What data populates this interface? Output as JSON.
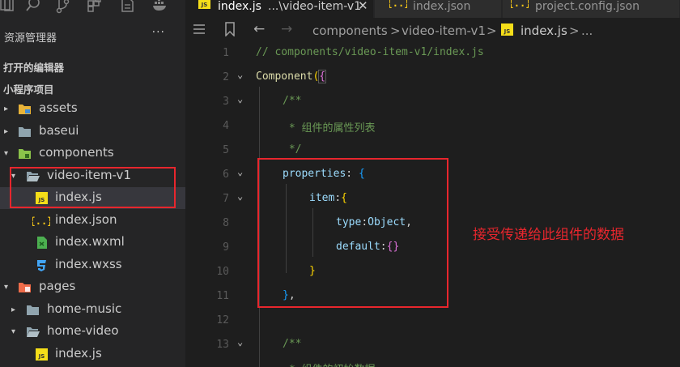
{
  "sidebar": {
    "title": "资源管理器",
    "more": "···",
    "section_open_editors": "打开的编辑器",
    "section_project": "小程序项目",
    "tree": [
      {
        "label": "assets",
        "icon": "folder-assets-icon"
      },
      {
        "label": "baseui",
        "icon": "folder-icon"
      },
      {
        "label": "components",
        "icon": "folder-components-icon"
      },
      {
        "label": "video-item-v1",
        "icon": "folder-open-icon"
      },
      {
        "label": "index.js",
        "icon": "js-file-icon"
      },
      {
        "label": "index.json",
        "icon": "json-file-icon"
      },
      {
        "label": "index.wxml",
        "icon": "wxml-file-icon"
      },
      {
        "label": "index.wxss",
        "icon": "wxss-file-icon"
      },
      {
        "label": "pages",
        "icon": "folder-pages-icon"
      },
      {
        "label": "home-music",
        "icon": "folder-icon"
      },
      {
        "label": "home-video",
        "icon": "folder-open-icon"
      },
      {
        "label": "index.js",
        "icon": "js-file-icon"
      }
    ]
  },
  "tabs": [
    {
      "name": "index.js",
      "hint": "...\\video-item-v1",
      "icon": "js-file-icon",
      "active": true
    },
    {
      "name": "index.json",
      "icon": "json-file-icon",
      "active": false
    },
    {
      "name": "project.config.json",
      "icon": "json-file-icon",
      "active": false
    }
  ],
  "breadcrumb": {
    "parts": [
      "components",
      "video-item-v1",
      "index.js",
      "..."
    ],
    "separator": ">"
  },
  "editor": {
    "line_numbers": [
      "1",
      "2",
      "3",
      "4",
      "5",
      "6",
      "7",
      "8",
      "9",
      "10",
      "11",
      "12",
      "13"
    ],
    "lines": {
      "l1": "// components/video-item-v1/index.js",
      "l2_func": "Component",
      "l2_paren": "(",
      "l2_brace": "{",
      "l3": "/**",
      "l4": " * 组件的属性列表",
      "l5": " */",
      "l6_prop": "properties",
      "l6_colon": ": ",
      "l6_brace": "{",
      "l7_prop": "item",
      "l7_colon": ":",
      "l7_brace": "{",
      "l8_prop": "type",
      "l8_colon": ":",
      "l8_val": "Object",
      "l8_comma": ",",
      "l9_prop": "default",
      "l9_colon": ":",
      "l9_val": "{}",
      "l10": "}",
      "l11_brace": "}",
      "l11_comma": ",",
      "l13": "/**",
      "l14": " * 组件的初始数据"
    },
    "annotation": "接受传递给此组件的数据"
  },
  "colors": {
    "accent_red": "#e8262d",
    "comment": "#6a9955",
    "property": "#9cdcfe",
    "function": "#dcdcaa"
  }
}
